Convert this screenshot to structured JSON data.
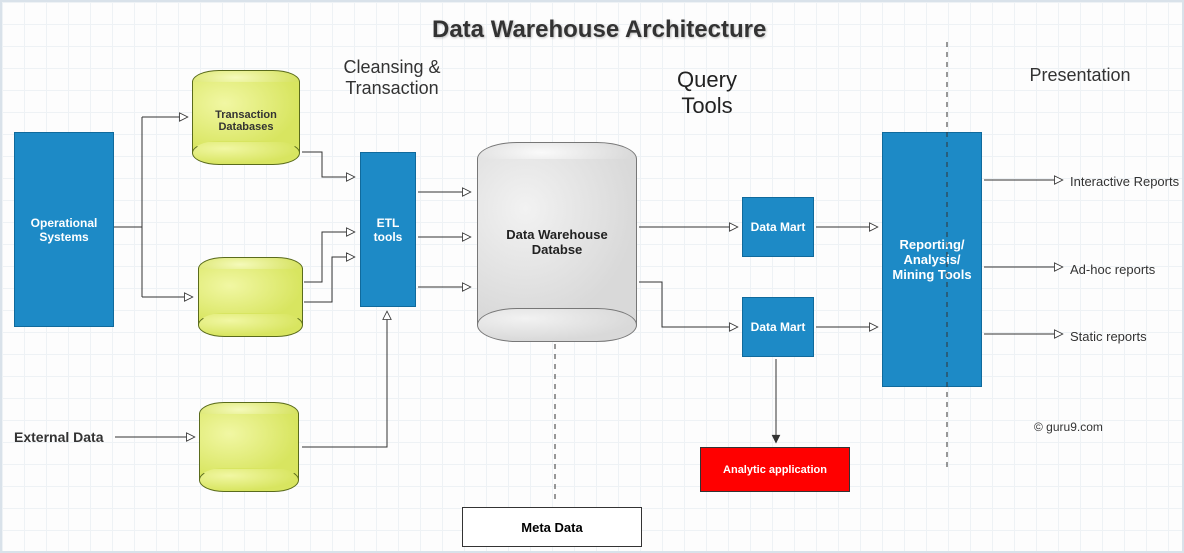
{
  "title": "Data Warehouse Architecture",
  "sections": {
    "cleansing": "Cleansing &\nTransaction",
    "query_tools": "Query\nTools",
    "presentation": "Presentation"
  },
  "nodes": {
    "operational_systems": "Operational Systems",
    "external_data": "External Data",
    "transaction_db": "Transaction Databases",
    "etl_tools": "ETL tools",
    "dwh_db": "Data Warehouse Databse",
    "data_mart_1": "Data Mart",
    "data_mart_2": "Data Mart",
    "reporting_tools": "Reporting/ Analysis/ Mining Tools",
    "analytic_app": "Analytic application",
    "meta_data": "Meta Data"
  },
  "outputs": {
    "interactive_reports": "Interactive Reports",
    "adhoc_reports": "Ad-hoc reports",
    "static_reports": "Static reports"
  },
  "credit": "© guru9.com"
}
